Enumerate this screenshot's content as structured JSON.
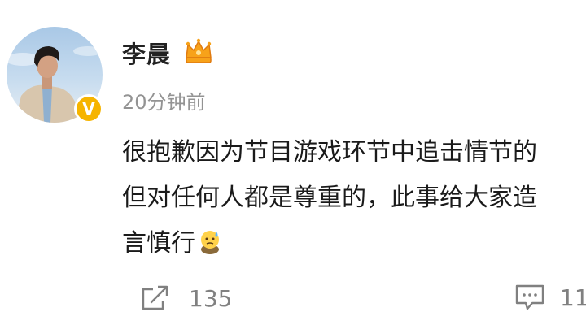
{
  "post": {
    "author": {
      "name": "李晨",
      "verified": true,
      "member_icon": "crown-icon"
    },
    "timestamp": "20分钟前",
    "body_lines": [
      "很抱歉因为节目游戏环节中追击情节的",
      "但对任何人都是尊重的，此事给大家造",
      "言慎行"
    ],
    "emoji": "sweat-emoji-icon"
  },
  "actions": {
    "repost": {
      "icon": "share-icon",
      "count": "135"
    },
    "comment": {
      "icon": "comment-icon",
      "count": "11"
    }
  },
  "colors": {
    "verified_badge": "#f6b400",
    "member_crown": "#f7a21a",
    "meta_text": "#939393",
    "body_text": "#1a1a1a"
  }
}
